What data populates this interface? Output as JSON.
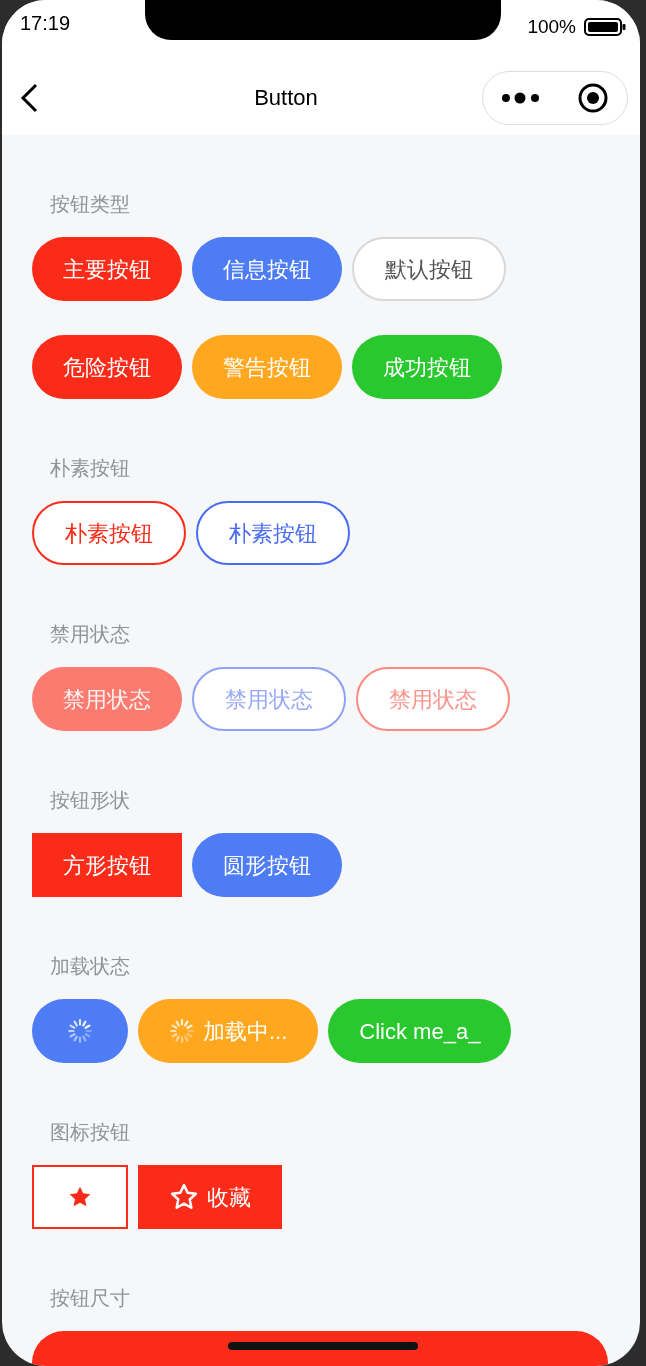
{
  "status_bar": {
    "time": "17:19",
    "battery": "100%"
  },
  "nav": {
    "title": "Button"
  },
  "sections": [
    {
      "title": "按钮类型",
      "buttons": [
        {
          "kind": "round",
          "color": "#fa2c19",
          "text": "主要按钮"
        },
        {
          "kind": "round",
          "color": "#4d7cf4",
          "text": "信息按钮"
        },
        {
          "kind": "round",
          "color": "#d8d8d8",
          "plain": true,
          "text": "默认按钮"
        },
        {
          "kind": "round",
          "color": "#fa2c19",
          "text": "危险按钮"
        },
        {
          "kind": "round",
          "color": "#ffa81f",
          "text": "警告按钮"
        },
        {
          "kind": "round",
          "color": "#29c82e",
          "text": "成功按钮"
        }
      ]
    },
    {
      "title": "朴素按钮",
      "buttons": [
        {
          "kind": "round",
          "color": "#fa2c19",
          "plain": true,
          "text": "朴素按钮"
        },
        {
          "kind": "round",
          "color": "#4a6cf2",
          "plain": true,
          "text": "朴素按钮"
        }
      ]
    },
    {
      "title": "禁用状态",
      "buttons": [
        {
          "kind": "round",
          "color": "#fc7b70",
          "disabled": true,
          "text": "禁用状态"
        },
        {
          "kind": "round",
          "color": "#8fa0f8",
          "plain": true,
          "disabled": true,
          "text": "禁用状态"
        },
        {
          "kind": "round",
          "color": "#fb8a80",
          "plain": true,
          "disabled": true,
          "text": "禁用状态"
        }
      ]
    },
    {
      "title": "按钮形状",
      "buttons": [
        {
          "kind": "square",
          "color": "#fa2c19",
          "text": "方形按钮"
        },
        {
          "kind": "round",
          "color": "#4d7cf4",
          "text": "圆形按钮"
        }
      ]
    },
    {
      "title": "加载状态",
      "buttons": [
        {
          "kind": "round",
          "color": "#4d7cf4",
          "loading": true
        },
        {
          "kind": "round",
          "color": "#ffa81f",
          "loading": true,
          "text": "加载中..."
        },
        {
          "kind": "round",
          "color": "#29c82e",
          "loading": false,
          "text": "Click me_a_"
        }
      ]
    },
    {
      "title": "图标按钮",
      "buttons": [
        {
          "kind": "icon",
          "color": "#fa2c19",
          "plain": true
        },
        {
          "kind": "icon",
          "color": "#fa2c19",
          "plain": false,
          "text": "收藏"
        }
      ]
    },
    {
      "title": "按钮尺寸",
      "buttons": [
        {
          "kind": "block",
          "color": "#fa2c19"
        }
      ]
    }
  ]
}
